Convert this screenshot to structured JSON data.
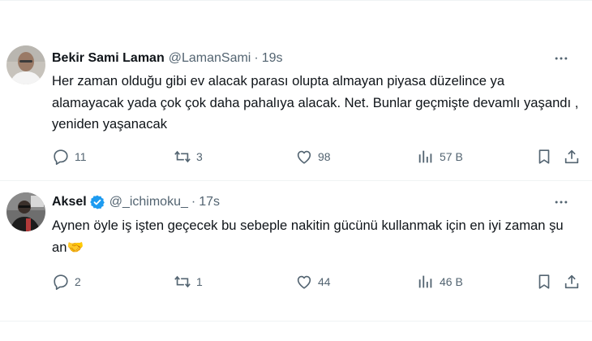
{
  "tweets": [
    {
      "name": "Bekir Sami Laman",
      "handle": "@LamanSami",
      "separator": "·",
      "time": "19s",
      "verified": false,
      "text": "Her zaman olduğu gibi ev alacak parası olupta almayan piyasa düzelince ya alamayacak yada çok çok daha pahalıya alacak. Net. Bunlar geçmişte devamlı yaşandı , yeniden yaşanacak",
      "replies": "11",
      "reposts": "3",
      "likes": "98",
      "views": "57 B"
    },
    {
      "name": "Aksel",
      "handle": "@_ichimoku_",
      "separator": "·",
      "time": "17s",
      "verified": true,
      "text": "Aynen öyle iş işten geçecek bu sebeple nakitin gücünü kullanmak için en iyi zaman şu an🤝",
      "replies": "2",
      "reposts": "1",
      "likes": "44",
      "views": "46 B"
    }
  ],
  "colors": {
    "text": "#0f1419",
    "secondary": "#536471",
    "verified": "#1d9bf0",
    "divider": "#eff3f4"
  },
  "icons": [
    "more-icon",
    "reply-icon",
    "repost-icon",
    "like-icon",
    "views-icon",
    "bookmark-icon",
    "share-icon",
    "verified-icon"
  ]
}
